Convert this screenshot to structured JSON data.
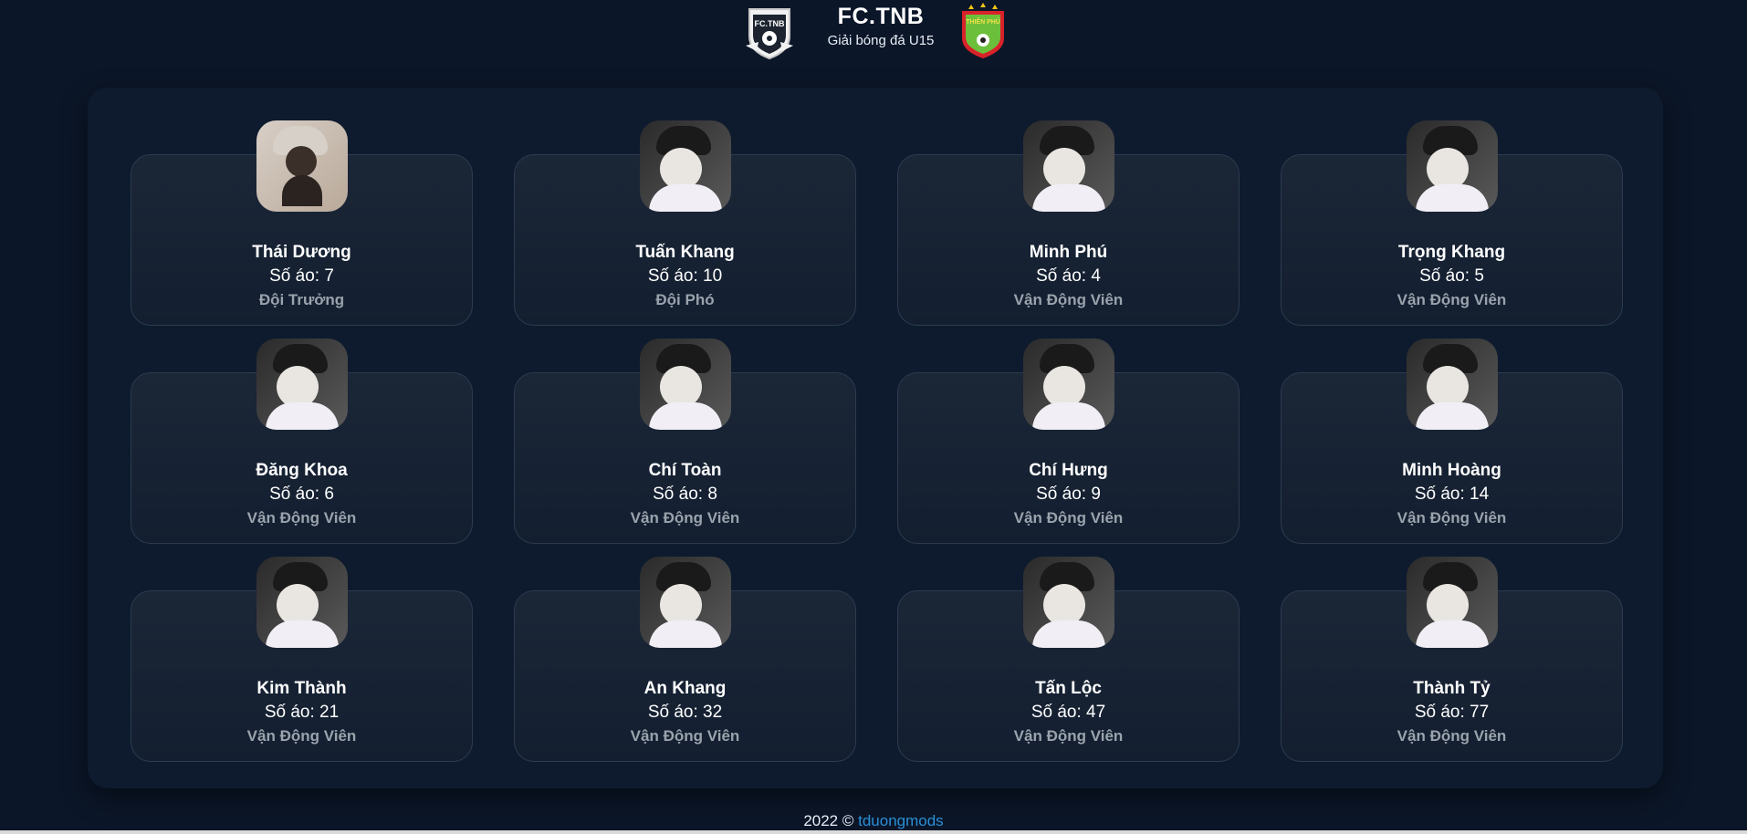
{
  "header": {
    "title": "FC.TNB",
    "subtitle": "Giải bóng đá U15",
    "left_logo_text": "FC.TNB",
    "right_logo_text": "THIÊN PHÚ"
  },
  "players": [
    {
      "name": "Thái Dương",
      "number": "Số áo: 7",
      "role": "Đội Trưởng"
    },
    {
      "name": "Tuấn Khang",
      "number": "Số áo: 10",
      "role": "Đội Phó"
    },
    {
      "name": "Minh Phú",
      "number": "Số áo: 4",
      "role": "Vận Động Viên"
    },
    {
      "name": "Trọng Khang",
      "number": "Số áo: 5",
      "role": "Vận Động Viên"
    },
    {
      "name": "Đăng Khoa",
      "number": "Số áo: 6",
      "role": "Vận Động Viên"
    },
    {
      "name": "Chí Toàn",
      "number": "Số áo: 8",
      "role": "Vận Động Viên"
    },
    {
      "name": "Chí Hưng",
      "number": "Số áo: 9",
      "role": "Vận Động Viên"
    },
    {
      "name": "Minh Hoàng",
      "number": "Số áo: 14",
      "role": "Vận Động Viên"
    },
    {
      "name": "Kim Thành",
      "number": "Số áo: 21",
      "role": "Vận Động Viên"
    },
    {
      "name": "An Khang",
      "number": "Số áo: 32",
      "role": "Vận Động Viên"
    },
    {
      "name": "Tấn Lộc",
      "number": "Số áo: 47",
      "role": "Vận Động Viên"
    },
    {
      "name": "Thành Tỷ",
      "number": "Số áo: 77",
      "role": "Vận Động Viên"
    }
  ],
  "footer": {
    "prefix": "2022 © ",
    "link_text": "tduongmods"
  },
  "colors": {
    "background": "#0b1628",
    "card": "#172233",
    "role_text": "#9aa3ad",
    "link": "#2a8fd6"
  }
}
